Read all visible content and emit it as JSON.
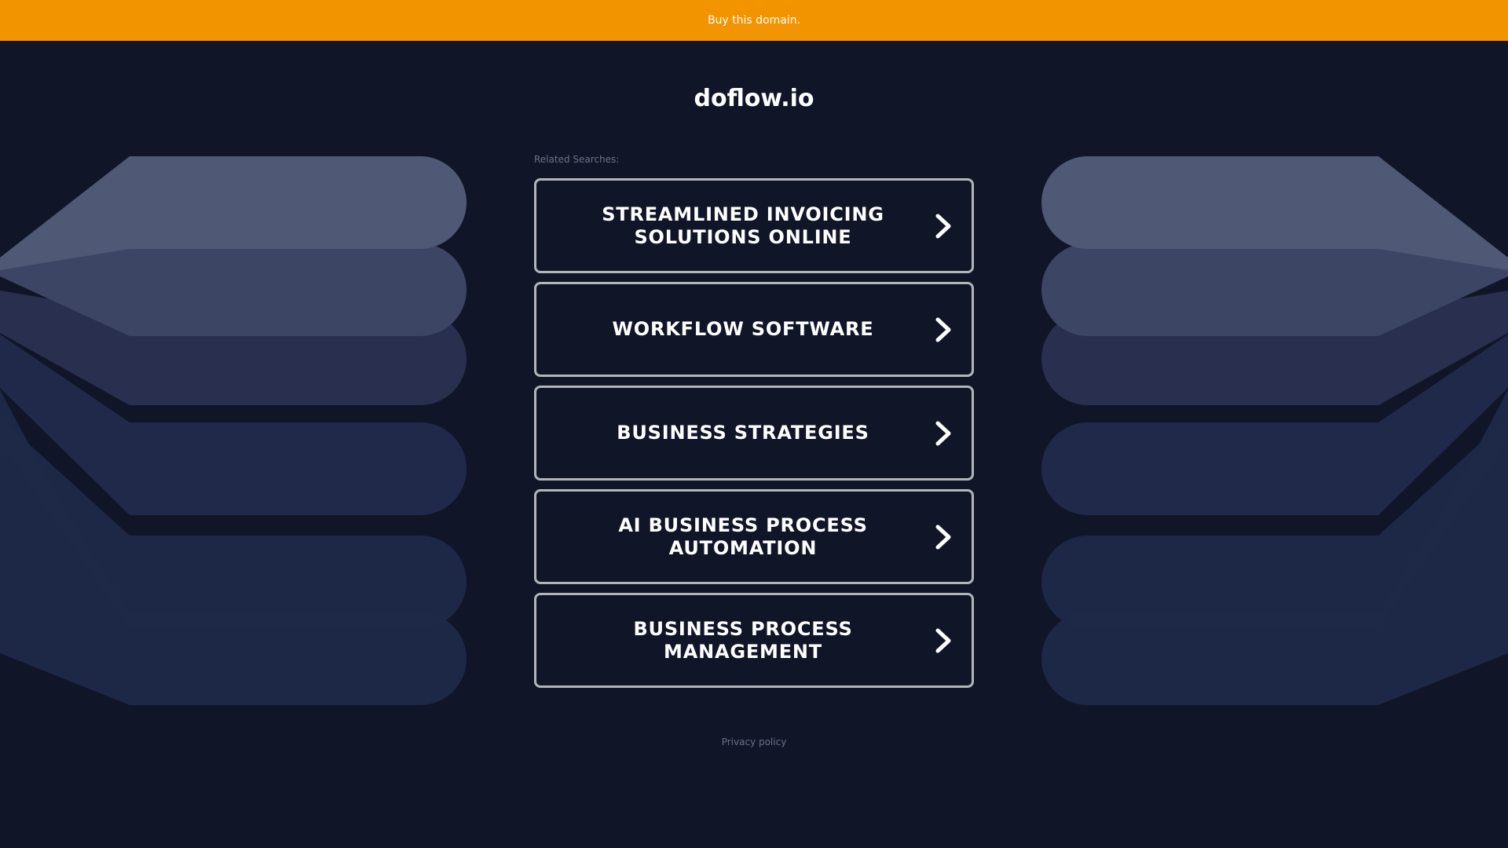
{
  "banner": {
    "text": "Buy this domain.",
    "color": "#f29400"
  },
  "domain": {
    "name": "doflow.io"
  },
  "related": {
    "label": "Related Searches:",
    "items": [
      {
        "label": "STREAMLINED INVOICING SOLUTIONS ONLINE"
      },
      {
        "label": "WORKFLOW SOFTWARE"
      },
      {
        "label": "BUSINESS STRATEGIES"
      },
      {
        "label": "AI BUSINESS PROCESS AUTOMATION"
      },
      {
        "label": "BUSINESS PROCESS MANAGEMENT"
      }
    ],
    "arrow_icon": "chevron-right-icon"
  },
  "footer": {
    "privacy_label": "Privacy policy"
  },
  "colors": {
    "background": "#101628",
    "box_border": "#b3b5bb",
    "muted_text": "#6b7387"
  }
}
